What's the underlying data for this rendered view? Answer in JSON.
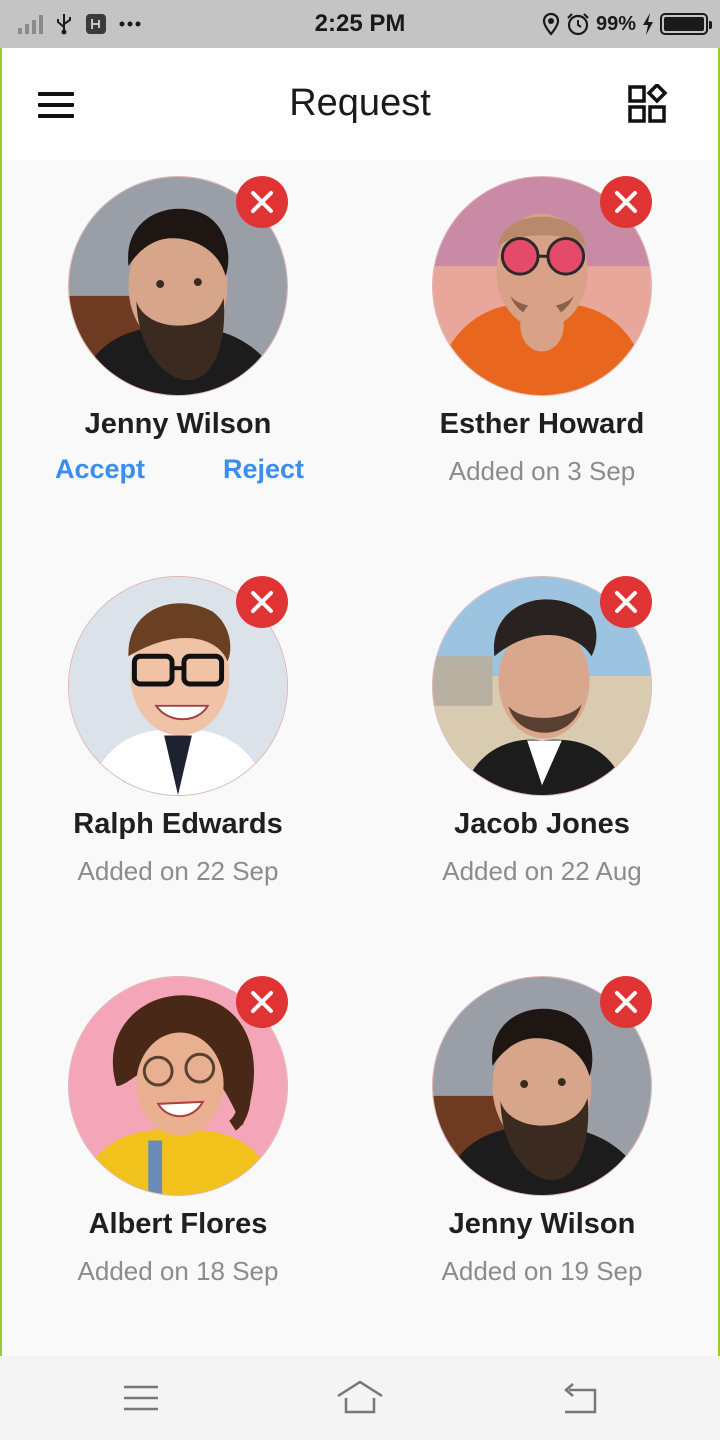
{
  "status_bar": {
    "time": "2:25 PM",
    "battery_percent": "99%",
    "battery_level": 0.99,
    "icons": [
      "signal-icon",
      "usb-icon",
      "usb-debug-icon",
      "more-dots-icon",
      "location-icon",
      "alarm-icon",
      "charging-icon",
      "battery-icon"
    ]
  },
  "app_bar": {
    "title": "Request",
    "left_icon": "hamburger-menu-icon",
    "right_icon": "apps-grid-icon"
  },
  "requests": [
    {
      "name": "Jenny Wilson",
      "accept_label": "Accept",
      "reject_label": "Reject",
      "avatar": "bearded-man-avatar"
    },
    {
      "name": "Esther Howard",
      "subtitle": "Added on 3 Sep",
      "avatar": "sunglasses-man-avatar"
    },
    {
      "name": "Ralph Edwards",
      "subtitle": "Added on 22 Sep",
      "avatar": "glasses-man-avatar"
    },
    {
      "name": "Jacob Jones",
      "subtitle": "Added on 22 Aug",
      "avatar": "man-outdoor-avatar"
    },
    {
      "name": "Albert Flores",
      "subtitle": "Added on 18 Sep",
      "avatar": "curly-woman-avatar"
    },
    {
      "name": "Jenny Wilson",
      "subtitle": "Added on 19 Sep",
      "avatar": "bearded-man-avatar"
    }
  ],
  "nav_bar": {
    "icons": [
      "recents-menu-icon",
      "home-icon",
      "back-icon"
    ]
  },
  "colors": {
    "accent": "#3a8ef0",
    "remove": "#e03434",
    "frame_border": "#9acd32",
    "background": "#f9f9f9"
  }
}
